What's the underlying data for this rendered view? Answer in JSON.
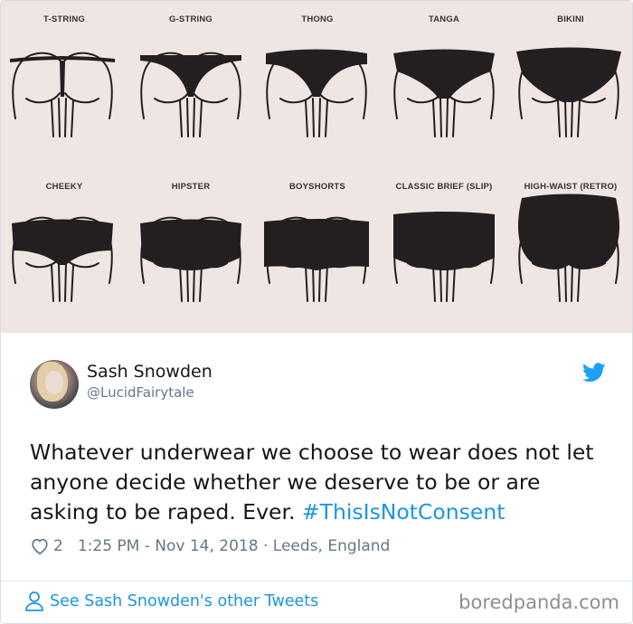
{
  "chart": {
    "row1": [
      "T-STRING",
      "G-STRING",
      "THONG",
      "TANGA",
      "BIKINI"
    ],
    "row2": [
      "CHEEKY",
      "HIPSTER",
      "BOYSHORTS",
      "CLASSIC BRIEF (SLIP)",
      "HIGH-WAIST (RETRO)"
    ]
  },
  "tweet": {
    "author_name": "Sash Snowden",
    "author_handle": "@LucidFairytale",
    "text": "Whatever underwear we choose to wear does not let anyone decide whether we deserve to be or are asking to be raped. Ever. ",
    "hashtag": "#ThisIsNotConsent",
    "likes": "2",
    "timestamp": "1:25 PM - Nov 14, 2018",
    "separator": " · ",
    "location": "Leeds, England"
  },
  "footer": {
    "link": "See Sash Snowden's other Tweets",
    "watermark": "boredpanda.com"
  },
  "colors": {
    "link": "#1b95e0",
    "secondary": "#657786",
    "garment": "#231f20",
    "chart_bg": "#efe6e4"
  },
  "icons": {
    "brand": "twitter-bird-icon",
    "like": "heart-icon",
    "profile": "person-icon"
  }
}
